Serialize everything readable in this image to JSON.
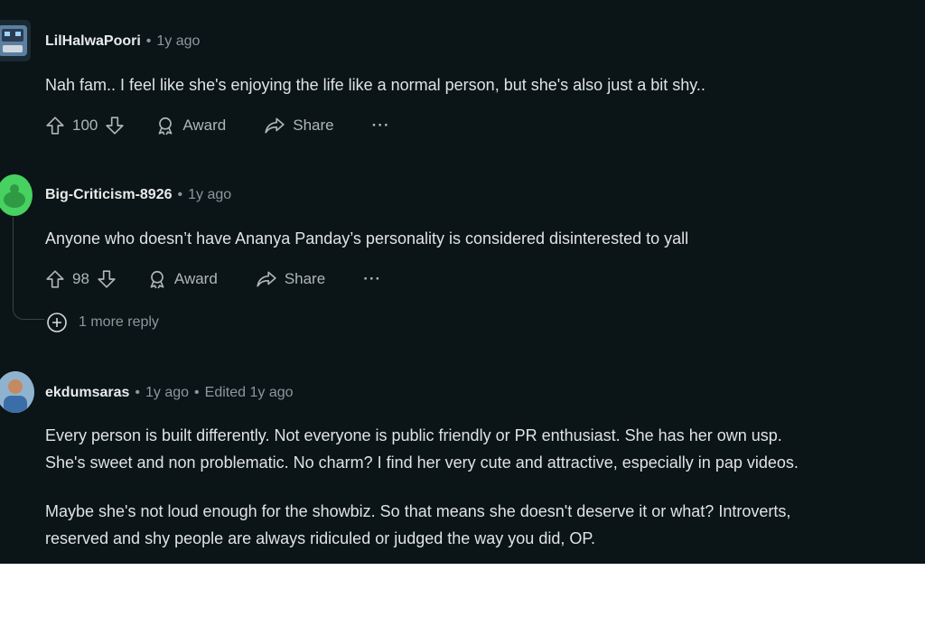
{
  "comments": [
    {
      "username": "LilHalwaPoori",
      "time": "1y ago",
      "body": [
        "Nah fam.. I feel like she's enjoying the life like a normal person, but she's also just a bit shy.."
      ],
      "votes": "100",
      "award_label": "Award",
      "share_label": "Share",
      "more_label": "···"
    },
    {
      "username": "Big-Criticism-8926",
      "time": "1y ago",
      "body": [
        "Anyone who doesn’t have Ananya Panday’s personality is considered disinterested to yall"
      ],
      "votes": "98",
      "award_label": "Award",
      "share_label": "Share",
      "more_label": "···",
      "more_replies": "1 more reply"
    },
    {
      "username": "ekdumsaras",
      "time": "1y ago",
      "edited": "Edited 1y ago",
      "body": [
        "Every person is built differently. Not everyone is public friendly or PR enthusiast. She has her own usp.",
        "She's sweet and non problematic. No charm? I find her very cute and attractive, especially in pap videos.",
        "Maybe she's not loud enough for the showbiz. So that means she doesn't deserve it or what? Introverts,",
        "reserved and shy people are always ridiculed or judged the way you did, OP."
      ]
    }
  ],
  "separator": "•",
  "colors": {
    "background": "#0b1416",
    "text": "#dfe3e5",
    "muted": "#8d979c",
    "avatar2": "#46d160"
  }
}
